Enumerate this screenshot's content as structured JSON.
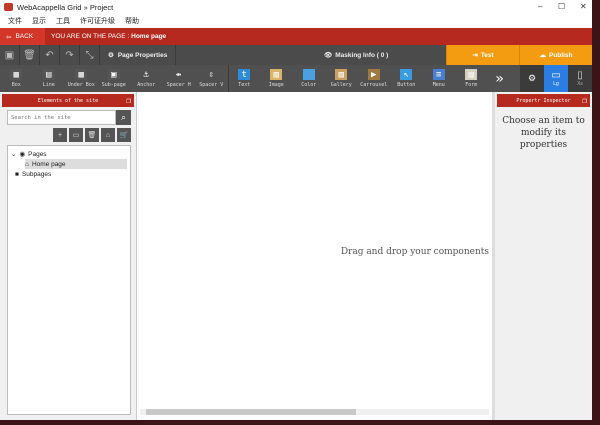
{
  "window": {
    "title": "WebAcappella Grid » Project",
    "controls": [
      "–",
      "☐",
      "✕"
    ]
  },
  "menu": [
    "文件",
    "显示",
    "工具",
    "许可证升级",
    "帮助"
  ],
  "navbar": {
    "back": "BACK",
    "page_prefix": "YOU ARE ON THE PAGE : ",
    "page_name": "Home page"
  },
  "toolbar": {
    "page_properties": "Page Properties",
    "masking_info": "Masking Info ( 0 )",
    "test": "Test",
    "publish": "Publish"
  },
  "components": [
    {
      "label": "Box",
      "icon": "▦",
      "color": "#555"
    },
    {
      "label": "Line",
      "icon": "▤",
      "color": "#555"
    },
    {
      "label": "Under Box",
      "icon": "▦",
      "color": "#555"
    },
    {
      "label": "Sub-page",
      "icon": "▣",
      "color": "#555"
    },
    {
      "label": "Anchor",
      "icon": "⚓",
      "color": "transparent"
    },
    {
      "label": "Spacer H",
      "icon": "⇹",
      "color": "transparent"
    },
    {
      "label": "Spacer V",
      "icon": "⇳",
      "color": "transparent"
    },
    {
      "label": "Text",
      "icon": "t",
      "color": "#2e8bd8"
    },
    {
      "label": "Image",
      "icon": "▨",
      "color": "#d9b56a"
    },
    {
      "label": "Color",
      "icon": "",
      "color": "#4aa0e0"
    },
    {
      "label": "Gallery",
      "icon": "▨",
      "color": "#c9a060"
    },
    {
      "label": "Carrousel",
      "icon": "▶",
      "color": "#a07840"
    },
    {
      "label": "Button",
      "icon": "↖",
      "color": "#3a9be0"
    },
    {
      "label": "Menu",
      "icon": "≡",
      "color": "#4a7fd0"
    },
    {
      "label": "Form",
      "icon": "▤",
      "color": "#d6d0c0"
    }
  ],
  "devices": {
    "lg": "Lg",
    "xs": "Xs"
  },
  "left_panel": {
    "title": "Elements of the site",
    "search_placeholder": "Search in the site",
    "tree": {
      "pages": "Pages",
      "home": "Home page",
      "subpages": "Subpages"
    }
  },
  "canvas": {
    "hint": "Drag and drop your components"
  },
  "right_panel": {
    "title": "Propertr Inspector",
    "hint": "Choose an item to modify its properties"
  }
}
